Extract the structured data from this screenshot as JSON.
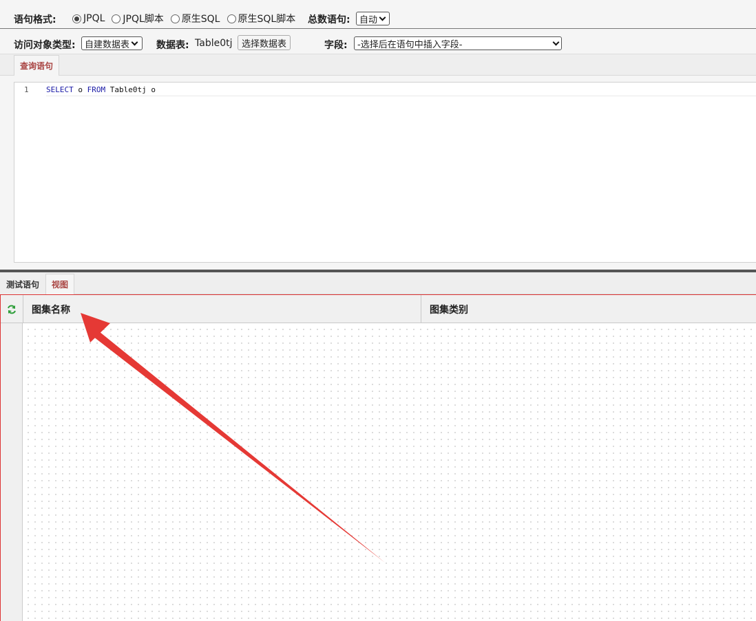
{
  "format": {
    "label": "语句格式:",
    "options": [
      "JPQL",
      "JPQL脚本",
      "原生SQL",
      "原生SQL脚本"
    ],
    "selected_index": 0,
    "total_label": "总数语句:",
    "total_value": "自动"
  },
  "access": {
    "type_label": "访问对象类型:",
    "type_value": "自建数据表",
    "table_label": "数据表:",
    "table_value": "Table0tj",
    "select_table_button": "选择数据表",
    "field_label": "字段:",
    "field_placeholder": "-选择后在语句中插入字段-"
  },
  "top_tabs": [
    {
      "label": "查询语句",
      "active": true
    }
  ],
  "editor": {
    "line_number": "1",
    "code": {
      "kw1": "SELECT",
      "t1": " o ",
      "kw2": "FROM",
      "t2": " Table0tj o"
    }
  },
  "bottom_tabs": [
    {
      "label": "测试语句",
      "active": false
    },
    {
      "label": "视图",
      "active": true
    }
  ],
  "grid": {
    "columns": [
      "图集名称",
      "图集类别"
    ]
  },
  "colors": {
    "accent": "#a94442",
    "annotation_arrow": "#e53935",
    "keyword": "#1a1aa6"
  },
  "icons": {
    "refresh": "refresh-icon",
    "dropdown": "chevron-down-icon"
  }
}
